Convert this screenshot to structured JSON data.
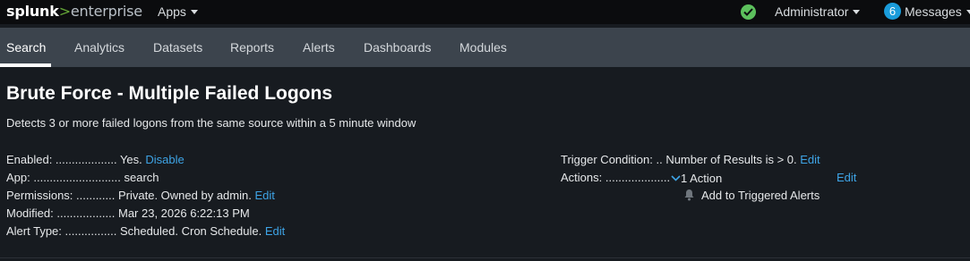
{
  "topbar": {
    "logo_part1": "splunk",
    "logo_part2": ">",
    "logo_part3": "enterprise",
    "apps_label": "Apps",
    "admin_label": "Administrator",
    "messages_count": "6",
    "messages_label": "Messages"
  },
  "nav": {
    "tabs": [
      "Search",
      "Analytics",
      "Datasets",
      "Reports",
      "Alerts",
      "Dashboards",
      "Modules"
    ],
    "active": "Search"
  },
  "alert": {
    "title": "Brute Force - Multiple Failed Logons",
    "description": "Detects 3 or more failed logons from the same source within a 5 minute window",
    "left": {
      "enabled_label": "Enabled: ...................",
      "enabled_value": "Yes.",
      "enabled_link": "Disable",
      "app_label": "App: ...........................",
      "app_value": "search",
      "permissions_label": "Permissions: ............",
      "permissions_value": "Private. Owned by admin.",
      "permissions_link": "Edit",
      "modified_label": "Modified: ..................",
      "modified_value": "Mar 23, 2026 6:22:13 PM",
      "alert_type_label": "Alert Type: ................",
      "alert_type_value": "Scheduled. Cron Schedule.",
      "alert_type_link": "Edit"
    },
    "right": {
      "trigger_label": "Trigger Condition: ..",
      "trigger_value": "Number of Results is > 0.",
      "trigger_link": "Edit",
      "actions_label": "Actions: ....................",
      "actions_value": "1 Action",
      "actions_link": "Edit",
      "action_item": "Add to Triggered Alerts"
    }
  },
  "colors": {
    "link": "#3ea4e6",
    "status_ok": "#5cc05c",
    "badge": "#1a9cdb",
    "logo_accent": "#65a637"
  }
}
